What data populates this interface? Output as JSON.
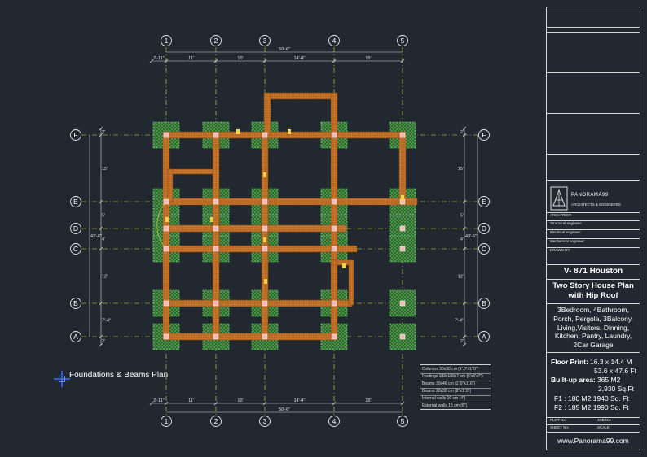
{
  "grid": {
    "columns": [
      "1",
      "2",
      "3",
      "4",
      "5"
    ],
    "rows": [
      "F",
      "E",
      "D",
      "C",
      "B",
      "A"
    ],
    "top_dims": [
      "2'-11\"",
      "11'",
      "10'",
      "14'-4\"",
      "15'"
    ],
    "top_total": "50'-6\"",
    "bottom_dims": [
      "2'-11\"",
      "11'",
      "10'",
      "14'-4\"",
      "15'"
    ],
    "bottom_total": "50'-6\"",
    "left_dims": [
      "2'",
      "15'",
      "5'",
      "4'",
      "12'",
      "7'-4\"",
      "2'"
    ],
    "left_total": "43'-6\"",
    "right_dims": [
      "2'",
      "15'",
      "5'",
      "4'",
      "12'",
      "7'-4\"",
      "2'"
    ],
    "right_total": "43'-6\""
  },
  "drawing_title": "Foundations & Beams Plan",
  "legend": {
    "rows": [
      "Columns 30x30 cm (1'.0\"x1'.0\")",
      "Footings 183x183x7 cm (6'x6'x7\")",
      "Beams   30x46 cm (1'.0\"x1'.6\")",
      "Beams   20x30 cm (8\"x1'.0\")",
      "Internal walls  10 cm (4\")",
      "External walls  15 cm (6\")"
    ]
  },
  "title_block": {
    "brand": "PANORAMA99",
    "brand_sub": "ARCHITECTS & ENGINEERS",
    "fields": [
      "ARCHITECT:",
      "Structural engineer:",
      "Electrical engineer:",
      "Mechanical engineer:",
      "DRAWN BY:"
    ],
    "project_code": "V- 871 Houston",
    "project_name_1": "Two Story House Plan",
    "project_name_2": "with Hip Roof",
    "desc": [
      "3Bedroom, 4Bathroom,",
      "Porch, Pergola, 3Balcony,",
      "Living,Visitors, Dinning,",
      "Kitchen, Pantry, Laundry,",
      "2Car Garage"
    ],
    "floor_print_label": "Floor Print:",
    "floor_print_m": "16.3 x 14.4 M",
    "floor_print_ft": "53.6 x 47.6 Ft",
    "built_area_label": "Built-up area:",
    "built_area_m": "365 M2",
    "built_area_ft": "2,930 Sq.Ft",
    "f1": "F1 : 180 M2   1940 Sq. Ft",
    "f2": "F2 : 185 M2   1990 Sq. Ft",
    "plot_no": "PLOT No:",
    "job_no": "JOB No:",
    "sheet_no": "SHEET No:",
    "scale": "SCALE:",
    "website": "www.Panorama99.com"
  },
  "colors": {
    "background": "#212830",
    "beam": "#c8752c",
    "footing": "#3fae3f",
    "column": "#f4b8b8",
    "axis": "#e0e040",
    "dim": "#d8d8d8"
  }
}
